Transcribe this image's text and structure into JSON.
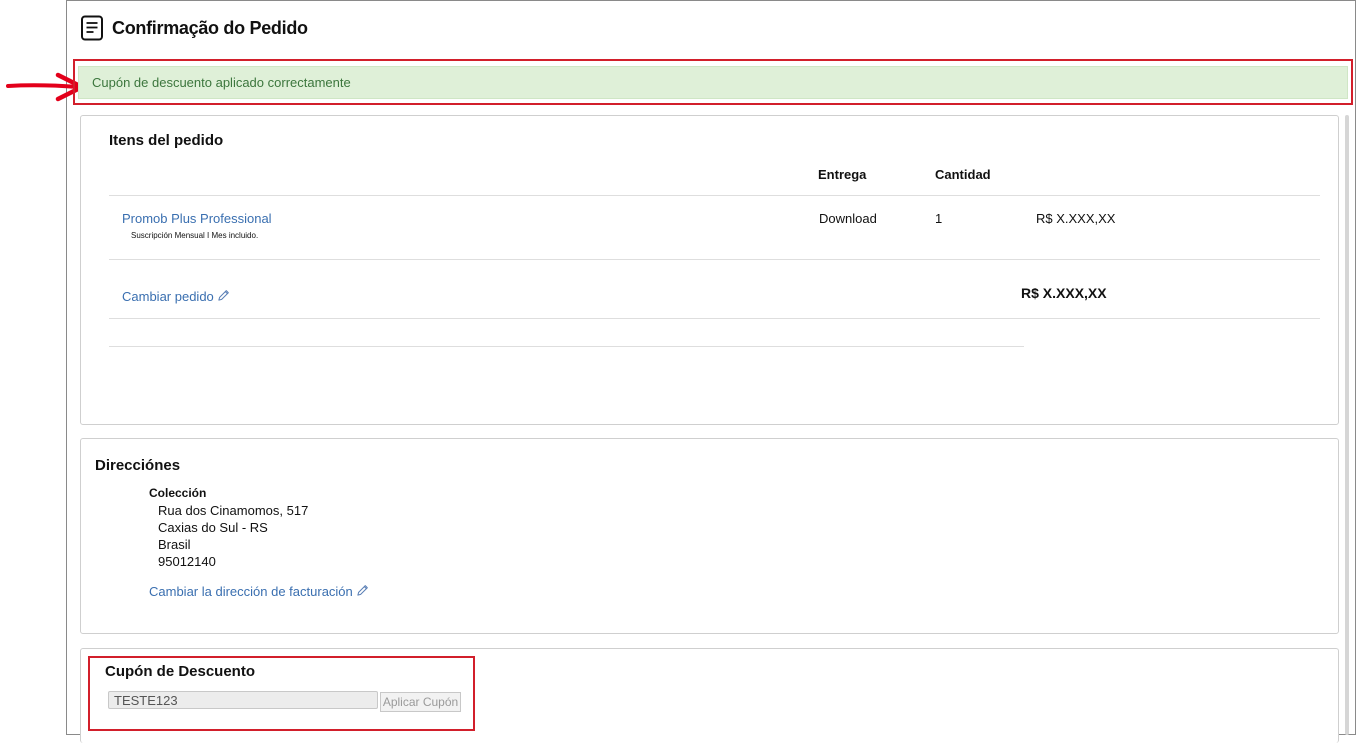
{
  "page": {
    "title": "Confirmação do Pedido",
    "alert": "Cupón de descuento aplicado correctamente"
  },
  "items": {
    "title": "Itens del pedido",
    "headers": {
      "delivery": "Entrega",
      "quantity": "Cantidad"
    },
    "rows": [
      {
        "product": "Promob Plus Professional",
        "subtitle": "Suscripción Mensual I Mes incluido.",
        "delivery": "Download",
        "quantity": "1",
        "price": "R$ X.XXX,XX"
      }
    ],
    "change_order": "Cambiar pedido",
    "total": "R$ X.XXX,XX"
  },
  "addresses": {
    "title": "Direcciónes",
    "label": "Colección",
    "lines": [
      "Rua dos Cinamomos, 517",
      "Caxias do Sul - RS",
      "Brasil",
      "95012140"
    ],
    "change_link": "Cambiar la dirección de facturación"
  },
  "coupon": {
    "title": "Cupón de Descuento",
    "value": "TESTE123",
    "button": "Aplicar Cupón"
  },
  "colors": {
    "alert_bg": "#dff0d8",
    "alert_text": "#3c763d",
    "link": "#3a6fb0",
    "highlight": "#d21f2b"
  }
}
